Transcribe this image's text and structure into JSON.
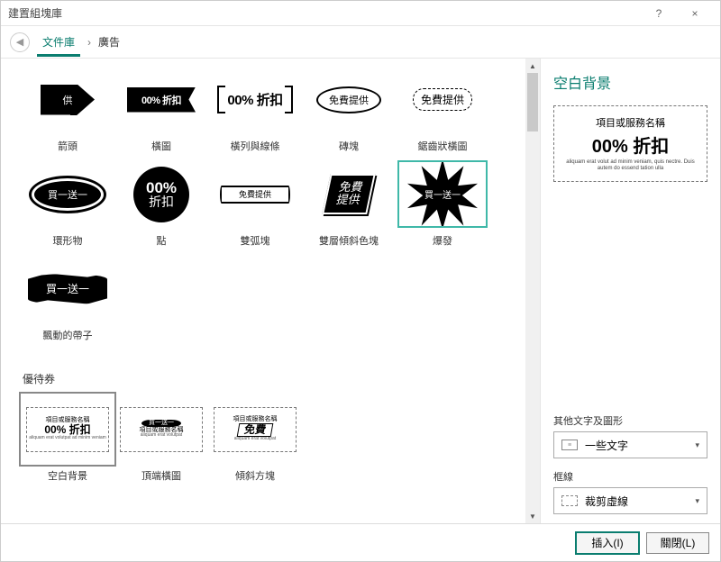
{
  "window": {
    "title": "建置組塊庫",
    "help": "?",
    "close": "×"
  },
  "breadcrumb": {
    "root": "文件庫",
    "sep": "›",
    "current": "廣告"
  },
  "gallery": {
    "row1": [
      {
        "label": "箭頭",
        "text": "供"
      },
      {
        "label": "橫圖",
        "text": "00% 折扣"
      },
      {
        "label": "橫列與線條",
        "text": "00% 折扣"
      },
      {
        "label": "磚塊",
        "text": "免費提供"
      },
      {
        "label": "鋸齒狀橫圖",
        "text": "免費提供"
      }
    ],
    "row2": [
      {
        "label": "環形物",
        "text": "買一送一"
      },
      {
        "label": "點",
        "big": "00%",
        "small": "折扣"
      },
      {
        "label": "雙弧塊",
        "text": "免費提供"
      },
      {
        "label": "雙層傾斜色塊",
        "l1": "免費",
        "l2": "提供"
      },
      {
        "label": "爆發",
        "text": "買一送一"
      }
    ],
    "row3": [
      {
        "label": "飄動的帶子",
        "text": "買一送一"
      }
    ],
    "section2": "優待券",
    "row4": [
      {
        "label": "空白背景",
        "l1": "項目或服務名稱",
        "l2": "00% 折扣",
        "l3": "aliquam erat volutpat ad minim veniam"
      },
      {
        "label": "頂端橫圖",
        "l1": "買一送一",
        "l2": "項目或服務名稱",
        "l3": "aliquam erat volutpat"
      },
      {
        "label": "傾斜方塊",
        "l1": "項目或服務名稱",
        "l2": "免費",
        "l3": "aliquam erat volutpat"
      }
    ]
  },
  "side": {
    "title": "空白背景",
    "preview": {
      "l1": "項目或服務名稱",
      "l2": "00% 折扣",
      "l3": "aliquam erat volut\nad minim veniam, quis nectre. Duis autem do\nessend tation ulla"
    },
    "field1_label": "其他文字及圖形",
    "field1_value": "一些文字",
    "field2_label": "框線",
    "field2_value": "裁剪虛線"
  },
  "footer": {
    "insert": "插入(I)",
    "close": "關閉(L)"
  }
}
